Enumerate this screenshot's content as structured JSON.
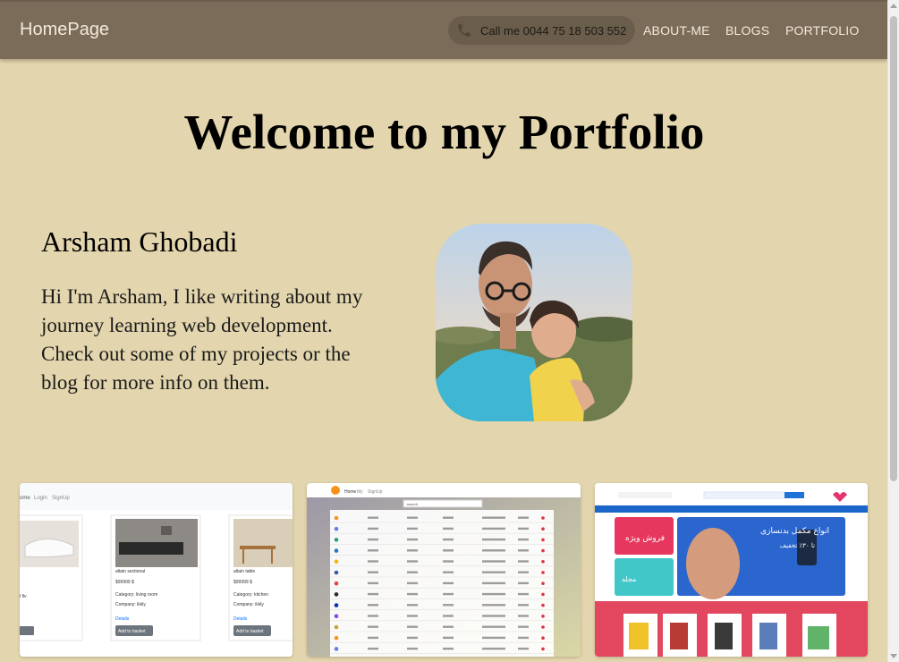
{
  "navbar": {
    "brand": "HomePage",
    "phone_label": "Call me 0044 75 18 503 552",
    "links": [
      "ABOUT-ME",
      "BLOGS",
      "PORTFOLIO"
    ]
  },
  "page_title": "Welcome to my Portfolio",
  "profile": {
    "name": "Arsham Ghobadi",
    "bio": "Hi I'm Arsham, I like writing about my journey learning web development. Check out some of my projects or the blog for more info on them."
  },
  "projects": {
    "shop": {
      "nav": [
        "ome",
        "Login",
        "SignUp"
      ],
      "products": [
        "altain sectional",
        "altain table"
      ],
      "prices": [
        "$99999 $",
        "$99999 $"
      ],
      "categories": [
        "Category: living room",
        "Category: kitchen"
      ],
      "companies": [
        "Company: ikkly",
        "Company: ikkly"
      ],
      "details": [
        "Details",
        "Details"
      ],
      "button": "Add to basket",
      "partial_left": [
        "l fiv",
        "Add to basket"
      ]
    },
    "crypto": {
      "nav": [
        "Home",
        "My",
        "SignUp"
      ],
      "search_placeholder": "search"
    },
    "store": {
      "banner_title": "انواع مکمل بدنسازی",
      "banner_sub": "تا ۳۰٪ تخفیف",
      "badge": "فروش ویژه",
      "side_label": "مجله"
    }
  },
  "colors": {
    "background": "#e3d5ad",
    "navbar": "#7a6c58",
    "pill": "#6a5d4b"
  }
}
